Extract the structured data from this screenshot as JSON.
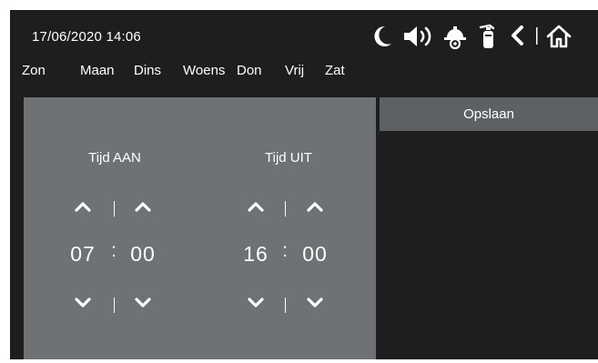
{
  "status_bar": {
    "datetime": "17/06/2020  14:06",
    "icons": [
      "moon-icon",
      "speaker-icon",
      "firefighter-helmet-icon",
      "fire-extinguisher-icon",
      "back-icon",
      "home-icon"
    ]
  },
  "days": [
    "Zon",
    "Maan",
    "Dins",
    "Woens",
    "Don",
    "Vrij",
    "Zat"
  ],
  "schedule": {
    "on": {
      "label": "Tijd AAN",
      "hour": "07",
      "minute": "00"
    },
    "off": {
      "label": "Tijd UIT",
      "hour": "16",
      "minute": "00"
    },
    "separator": ":"
  },
  "save_label": "Opslaan",
  "colors": {
    "background": "#1e1e1e",
    "panel": "#6e7275",
    "save_button": "#5e6163",
    "text": "#ffffff"
  }
}
